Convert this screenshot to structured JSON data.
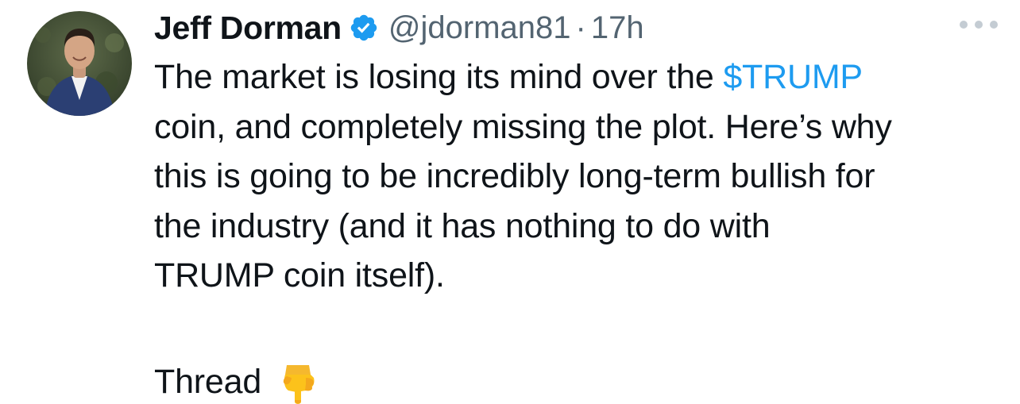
{
  "author": {
    "name": "Jeff Dorman",
    "handle": "@jdorman81",
    "separator": "·",
    "time": "17h",
    "verified_icon": "verified-badge-icon",
    "avatar_icon": "avatar"
  },
  "tweet": {
    "line1_prefix": "The market is losing its mind over the ",
    "cashtag": "$TRUMP",
    "line2": "coin, and completely missing the plot. Here’s why",
    "line3": "this is going to be incredibly long-term bullish for",
    "line4": "the industry (and it has nothing to do with",
    "line5": "TRUMP coin itself).",
    "thread_label": "Thread",
    "thread_emoji_icon": "pointing-down-hand-icon"
  },
  "menu": {
    "more_icon": "more-options-icon"
  },
  "colors": {
    "text": "#0f1419",
    "secondary": "#536471",
    "accent": "#1d9bf0",
    "verified": "#1d9bf0"
  }
}
